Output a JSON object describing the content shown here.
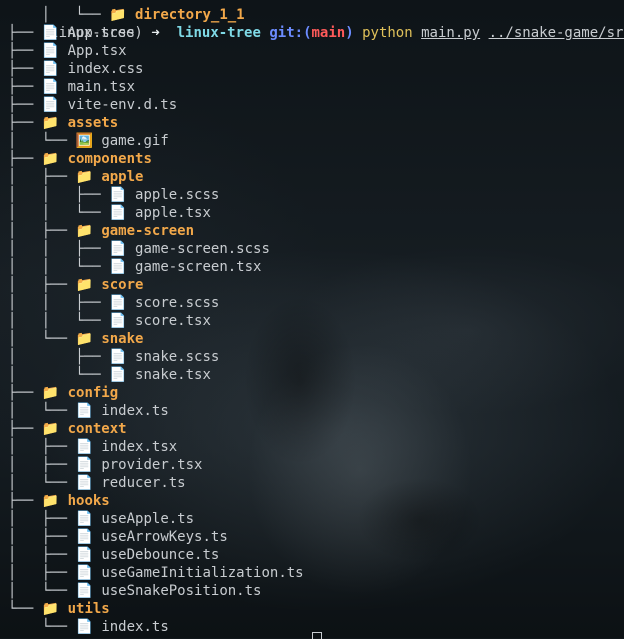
{
  "prompt": {
    "env": "(linux-tree)",
    "arrow": "➜",
    "directory": "linux-tree",
    "git_label": "git:",
    "branch_open": "(",
    "branch": "main",
    "branch_close": ")",
    "command": "python",
    "script": "main.py",
    "argument": "../snake-game/src"
  },
  "partial_top": "directory_1_1",
  "tree": [
    {
      "prefix": "├── ",
      "type": "file",
      "icon": "📄",
      "name": "App.scss"
    },
    {
      "prefix": "├── ",
      "type": "file",
      "icon": "📄",
      "name": "App.tsx"
    },
    {
      "prefix": "├── ",
      "type": "file",
      "icon": "📄",
      "name": "index.css"
    },
    {
      "prefix": "├── ",
      "type": "file",
      "icon": "📄",
      "name": "main.tsx"
    },
    {
      "prefix": "├── ",
      "type": "file",
      "icon": "📄",
      "name": "vite-env.d.ts"
    },
    {
      "prefix": "├── ",
      "type": "dir",
      "icon": "📁",
      "name": "assets"
    },
    {
      "prefix": "│   └── ",
      "type": "file",
      "icon": "🖼️",
      "name": "game.gif"
    },
    {
      "prefix": "├── ",
      "type": "dir",
      "icon": "📁",
      "name": "components"
    },
    {
      "prefix": "│   ├── ",
      "type": "dir",
      "icon": "📁",
      "name": "apple"
    },
    {
      "prefix": "│   │   ├── ",
      "type": "file",
      "icon": "📄",
      "name": "apple.scss"
    },
    {
      "prefix": "│   │   └── ",
      "type": "file",
      "icon": "📄",
      "name": "apple.tsx"
    },
    {
      "prefix": "│   ├── ",
      "type": "dir",
      "icon": "📁",
      "name": "game-screen"
    },
    {
      "prefix": "│   │   ├── ",
      "type": "file",
      "icon": "📄",
      "name": "game-screen.scss"
    },
    {
      "prefix": "│   │   └── ",
      "type": "file",
      "icon": "📄",
      "name": "game-screen.tsx"
    },
    {
      "prefix": "│   ├── ",
      "type": "dir",
      "icon": "📁",
      "name": "score"
    },
    {
      "prefix": "│   │   ├── ",
      "type": "file",
      "icon": "📄",
      "name": "score.scss"
    },
    {
      "prefix": "│   │   └── ",
      "type": "file",
      "icon": "📄",
      "name": "score.tsx"
    },
    {
      "prefix": "│   └── ",
      "type": "dir",
      "icon": "📁",
      "name": "snake"
    },
    {
      "prefix": "│       ├── ",
      "type": "file",
      "icon": "📄",
      "name": "snake.scss"
    },
    {
      "prefix": "│       └── ",
      "type": "file",
      "icon": "📄",
      "name": "snake.tsx"
    },
    {
      "prefix": "├── ",
      "type": "dir",
      "icon": "📁",
      "name": "config"
    },
    {
      "prefix": "│   └── ",
      "type": "file",
      "icon": "📄",
      "name": "index.ts"
    },
    {
      "prefix": "├── ",
      "type": "dir",
      "icon": "📁",
      "name": "context"
    },
    {
      "prefix": "│   ├── ",
      "type": "file",
      "icon": "📄",
      "name": "index.tsx"
    },
    {
      "prefix": "│   ├── ",
      "type": "file",
      "icon": "📄",
      "name": "provider.tsx"
    },
    {
      "prefix": "│   └── ",
      "type": "file",
      "icon": "📄",
      "name": "reducer.ts"
    },
    {
      "prefix": "├── ",
      "type": "dir",
      "icon": "📁",
      "name": "hooks"
    },
    {
      "prefix": "│   ├── ",
      "type": "file",
      "icon": "📄",
      "name": "useApple.ts"
    },
    {
      "prefix": "│   ├── ",
      "type": "file",
      "icon": "📄",
      "name": "useArrowKeys.ts"
    },
    {
      "prefix": "│   ├── ",
      "type": "file",
      "icon": "📄",
      "name": "useDebounce.ts"
    },
    {
      "prefix": "│   ├── ",
      "type": "file",
      "icon": "📄",
      "name": "useGameInitialization.ts"
    },
    {
      "prefix": "│   └── ",
      "type": "file",
      "icon": "📄",
      "name": "useSnakePosition.ts"
    },
    {
      "prefix": "└── ",
      "type": "dir",
      "icon": "📁",
      "name": "utils"
    },
    {
      "prefix": "    └── ",
      "type": "file",
      "icon": "📄",
      "name": "index.ts"
    }
  ]
}
